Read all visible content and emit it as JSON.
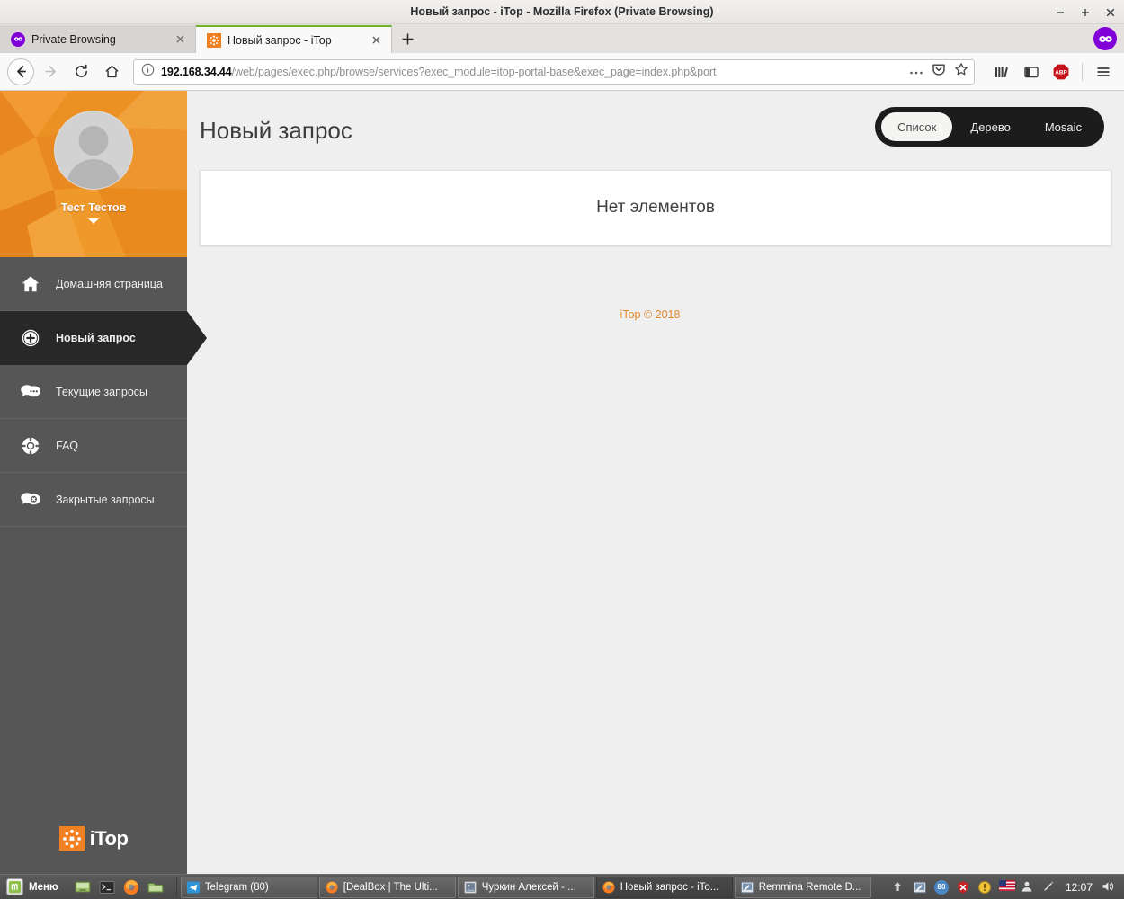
{
  "window": {
    "title": "Новый запрос - iTop - Mozilla Firefox (Private Browsing)",
    "minimize_label": "−",
    "maximize_label": "+",
    "close_label": "×",
    "private_badge_icon": "private-mask-icon"
  },
  "browser": {
    "tabs": [
      {
        "label": "Private Browsing",
        "favicon": "private-mask-icon",
        "active": false
      },
      {
        "label": "Новый запрос - iTop",
        "favicon": "itop-favicon",
        "active": true
      }
    ],
    "new_tab_label": "+",
    "nav": {
      "back_icon": "back-arrow-icon",
      "forward_icon": "forward-arrow-icon",
      "reload_icon": "reload-icon",
      "home_icon": "home-icon"
    },
    "urlbar": {
      "identity_icon": "info-circle-icon",
      "host": "192.168.34.44",
      "path": "/web/pages/exec.php/browse/services?exec_module=itop-portal-base&exec_page=index.php&port",
      "page_actions_icon": "ellipsis-icon",
      "save_to_pocket_icon": "pocket-icon",
      "bookmark_icon": "star-icon"
    },
    "toolbar": {
      "library_icon": "library-icon",
      "sidebar_icon": "sidebar-icon",
      "adblock_label": "ABP",
      "adblock_icon": "adblock-plus-icon",
      "menu_icon": "hamburger-menu-icon"
    }
  },
  "portal": {
    "user": {
      "name": "Тест Тестов",
      "avatar_icon": "user-avatar-icon",
      "caret_icon": "chevron-down-icon"
    },
    "menu": [
      {
        "label": "Домашняя страница",
        "icon": "home-icon",
        "active": false
      },
      {
        "label": "Новый запрос",
        "icon": "plus-circle-icon",
        "active": true
      },
      {
        "label": "Текущие запросы",
        "icon": "speech-bubbles-icon",
        "active": false
      },
      {
        "label": "FAQ",
        "icon": "lifebuoy-icon",
        "active": false
      },
      {
        "label": "Закрытые запросы",
        "icon": "speech-bubble-close-icon",
        "active": false
      }
    ],
    "logo": {
      "mark_icon": "itop-logo-mark",
      "word": "iTop",
      "accent_color": "#f08022"
    },
    "page_title": "Новый запрос",
    "view_toggle": [
      {
        "label": "Список",
        "active": true
      },
      {
        "label": "Дерево",
        "active": false
      },
      {
        "label": "Mosaic",
        "active": false
      }
    ],
    "empty_message": "Нет элементов",
    "footer": "iTop © 2018"
  },
  "taskbar": {
    "menu_label": "Меню",
    "menu_icon": "linux-mint-icon",
    "launchers": [
      {
        "icon": "show-desktop-icon"
      },
      {
        "icon": "terminal-icon"
      },
      {
        "icon": "firefox-icon"
      },
      {
        "icon": "file-manager-icon"
      }
    ],
    "windows": [
      {
        "label": "Telegram (80)",
        "icon": "telegram-icon",
        "active": false
      },
      {
        "label": "[DealBox | The Ulti...",
        "icon": "firefox-icon",
        "active": false
      },
      {
        "label": "Чуркин Алексей - ...",
        "icon": "image-viewer-icon",
        "active": false
      },
      {
        "label": "Новый запрос - iTo...",
        "icon": "firefox-icon",
        "active": true
      },
      {
        "label": "Remmina Remote D...",
        "icon": "remmina-icon",
        "active": false
      }
    ],
    "tray": [
      {
        "icon": "up-arrow-icon"
      },
      {
        "icon": "remmina-icon"
      },
      {
        "icon": "telegram-count-badge",
        "label": "80"
      },
      {
        "icon": "shield-red-icon"
      },
      {
        "icon": "update-circle-icon"
      },
      {
        "icon": "us-flag-icon"
      },
      {
        "icon": "user-icon"
      },
      {
        "icon": "pen-icon"
      }
    ],
    "clock": "12:07",
    "volume_icon": "speaker-icon"
  }
}
